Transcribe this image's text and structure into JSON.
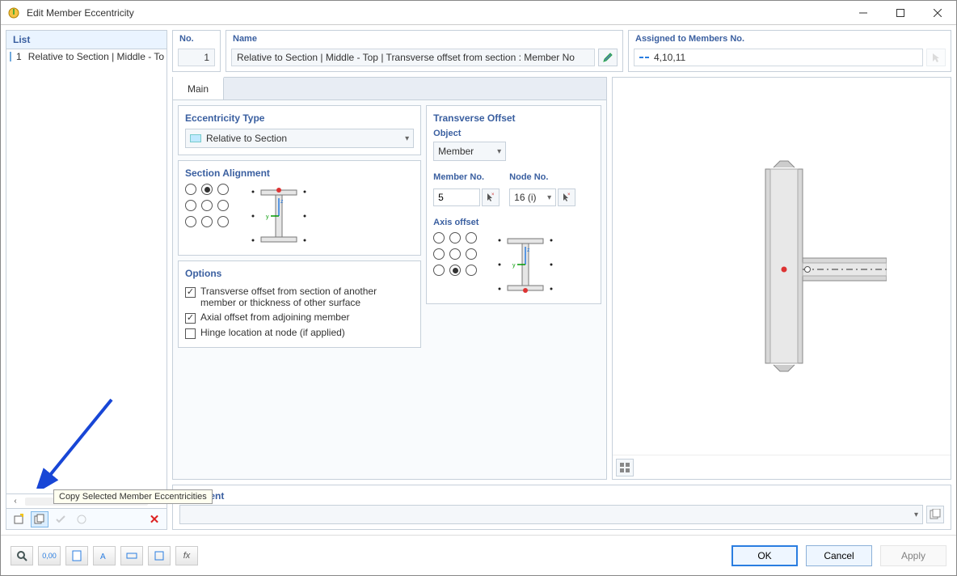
{
  "window": {
    "title": "Edit Member Eccentricity"
  },
  "left": {
    "header": "List",
    "row": {
      "num": "1",
      "text": "Relative to Section | Middle - To"
    },
    "tooltip": "Copy Selected Member Eccentricities"
  },
  "top": {
    "no_label": "No.",
    "no_value": "1",
    "name_label": "Name",
    "name_value": "Relative to Section | Middle - Top | Transverse offset from section : Member No",
    "assigned_label": "Assigned to Members No.",
    "assigned_value": "4,10,11"
  },
  "tab": {
    "main": "Main"
  },
  "ecc_type": {
    "title": "Eccentricity Type",
    "value": "Relative to Section"
  },
  "section_alignment": {
    "title": "Section Alignment"
  },
  "options": {
    "title": "Options",
    "opt1": "Transverse offset from section of another member or thickness of other surface",
    "opt2": "Axial offset from adjoining member",
    "opt3": "Hinge location at node (if applied)"
  },
  "transverse": {
    "title": "Transverse Offset",
    "object_label": "Object",
    "object_value": "Member",
    "member_no_label": "Member No.",
    "member_no_value": "5",
    "node_no_label": "Node No.",
    "node_no_value": "16 (i)",
    "axis_label": "Axis offset"
  },
  "comment": {
    "title": "Comment"
  },
  "buttons": {
    "ok": "OK",
    "cancel": "Cancel",
    "apply": "Apply"
  }
}
